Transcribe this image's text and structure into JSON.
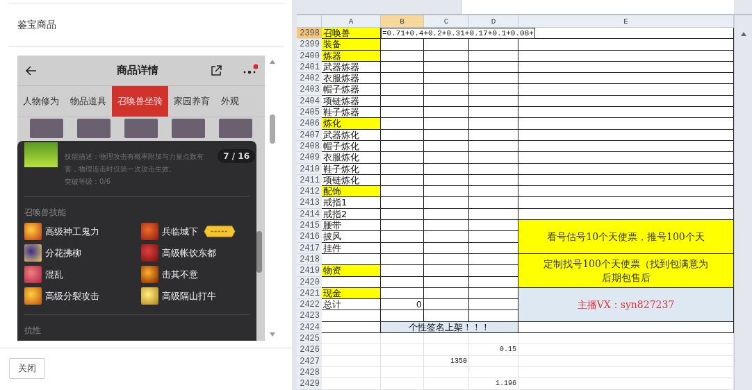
{
  "dialog": {
    "title": "鉴宝商品",
    "close_button": "关闭"
  },
  "phone": {
    "title": "商品详情",
    "tabs": [
      {
        "label": "人物修为",
        "selected": false
      },
      {
        "label": "物品道具",
        "selected": false
      },
      {
        "label": "召唤兽坐骑",
        "selected": true
      },
      {
        "label": "家园养育",
        "selected": false
      },
      {
        "label": "外观",
        "selected": false
      }
    ],
    "skill_detail": {
      "description_lines": [
        "技能描述：物理攻击有概率附加与力量点数有",
        "害，物理连击时仅第一次攻击生效。"
      ],
      "breakthrough": "突破等级：0/6",
      "page_badge": "7 / 16"
    },
    "skills_heading": "召唤兽技能",
    "skills": [
      {
        "name": "高级神工鬼力"
      },
      {
        "name": "兵临城下",
        "tagged": true
      },
      {
        "name": "分花拂柳"
      },
      {
        "name": "高级帐饮东都"
      },
      {
        "name": "混乱"
      },
      {
        "name": "击其不意"
      },
      {
        "name": "高级分裂攻击"
      },
      {
        "name": "高级隔山打牛"
      }
    ],
    "resist_heading": "抗性"
  },
  "sheet": {
    "columns": [
      {
        "label": "A",
        "selected": false
      },
      {
        "label": "B",
        "selected": true
      },
      {
        "label": "C",
        "selected": false
      },
      {
        "label": "D",
        "selected": false
      },
      {
        "label": "E",
        "selected": false
      }
    ],
    "rows": [
      {
        "num": "2398",
        "selected": true,
        "bordered": true,
        "a": "召唤兽",
        "color": "#ffff00",
        "b": "=0.71+0.4+0.2+0.31+0.17+0.1+0.08+"
      },
      {
        "num": "2399",
        "selected": false,
        "bordered": true,
        "a": "装备",
        "color": "#ffff00"
      },
      {
        "num": "2400",
        "selected": false,
        "bordered": true,
        "a": "炼器",
        "color": "#ffff00"
      },
      {
        "num": "2401",
        "selected": false,
        "bordered": true,
        "a": "武器炼器"
      },
      {
        "num": "2402",
        "selected": false,
        "bordered": true,
        "a": "衣服炼器"
      },
      {
        "num": "2403",
        "selected": false,
        "bordered": true,
        "a": "帽子炼器"
      },
      {
        "num": "2404",
        "selected": false,
        "bordered": true,
        "a": "项链炼器"
      },
      {
        "num": "2405",
        "selected": false,
        "bordered": true,
        "a": "鞋子炼器"
      },
      {
        "num": "2406",
        "selected": false,
        "bordered": true,
        "a": "炼化",
        "color": "#ffff00"
      },
      {
        "num": "2407",
        "selected": false,
        "bordered": true,
        "a": "武器炼化"
      },
      {
        "num": "2408",
        "selected": false,
        "bordered": true,
        "a": "帽子炼化"
      },
      {
        "num": "2409",
        "selected": false,
        "bordered": true,
        "a": "衣服炼化"
      },
      {
        "num": "2410",
        "selected": false,
        "bordered": true,
        "a": "鞋子炼化"
      },
      {
        "num": "2411",
        "selected": false,
        "bordered": true,
        "a": "项链炼化"
      },
      {
        "num": "2412",
        "selected": false,
        "bordered": true,
        "a": "配饰",
        "color": "#ffff00"
      },
      {
        "num": "2413",
        "selected": false,
        "bordered": true,
        "a": "戒指1"
      },
      {
        "num": "2414",
        "selected": false,
        "bordered": true,
        "a": "戒指2"
      },
      {
        "num": "2415",
        "selected": false,
        "bordered": true,
        "a": "腰带",
        "e": {
          "kind": "notice",
          "lines": [
            "看号估号10个天使票，推号100个天"
          ]
        }
      },
      {
        "num": "2416",
        "selected": false,
        "bordered": true,
        "a": "披风"
      },
      {
        "num": "2417",
        "selected": false,
        "bordered": true,
        "a": "挂件"
      },
      {
        "num": "2418",
        "selected": false,
        "bordered": true,
        "e": {
          "kind": "notice",
          "lines": [
            "定制找号100个天使票（找到包满意为",
            "后期包售后"
          ]
        }
      },
      {
        "num": "2419",
        "selected": false,
        "bordered": true,
        "a": "物资",
        "color": "#ffff00"
      },
      {
        "num": "2420",
        "selected": false,
        "bordered": true
      },
      {
        "num": "2421",
        "selected": false,
        "bordered": true,
        "a": "现金",
        "color": "#ffff00",
        "e": {
          "kind": "contact",
          "lines": [
            "主播VX：syn827237"
          ]
        }
      },
      {
        "num": "2422",
        "selected": false,
        "bordered": true,
        "a": "总计",
        "b": "0"
      },
      {
        "num": "2423",
        "selected": false,
        "bordered": true
      },
      {
        "num": "2424",
        "selected": false,
        "bordered": true,
        "bcd": "个性签名上架！！！"
      },
      {
        "num": "2425",
        "selected": false,
        "bordered": false
      },
      {
        "num": "2426",
        "selected": false,
        "bordered": false,
        "d": "0.15"
      },
      {
        "num": "2427",
        "selected": false,
        "bordered": false,
        "c": "1350"
      },
      {
        "num": "2428",
        "selected": false,
        "bordered": false
      },
      {
        "num": "2429",
        "selected": false,
        "bordered": false,
        "d": "1.196"
      }
    ]
  }
}
